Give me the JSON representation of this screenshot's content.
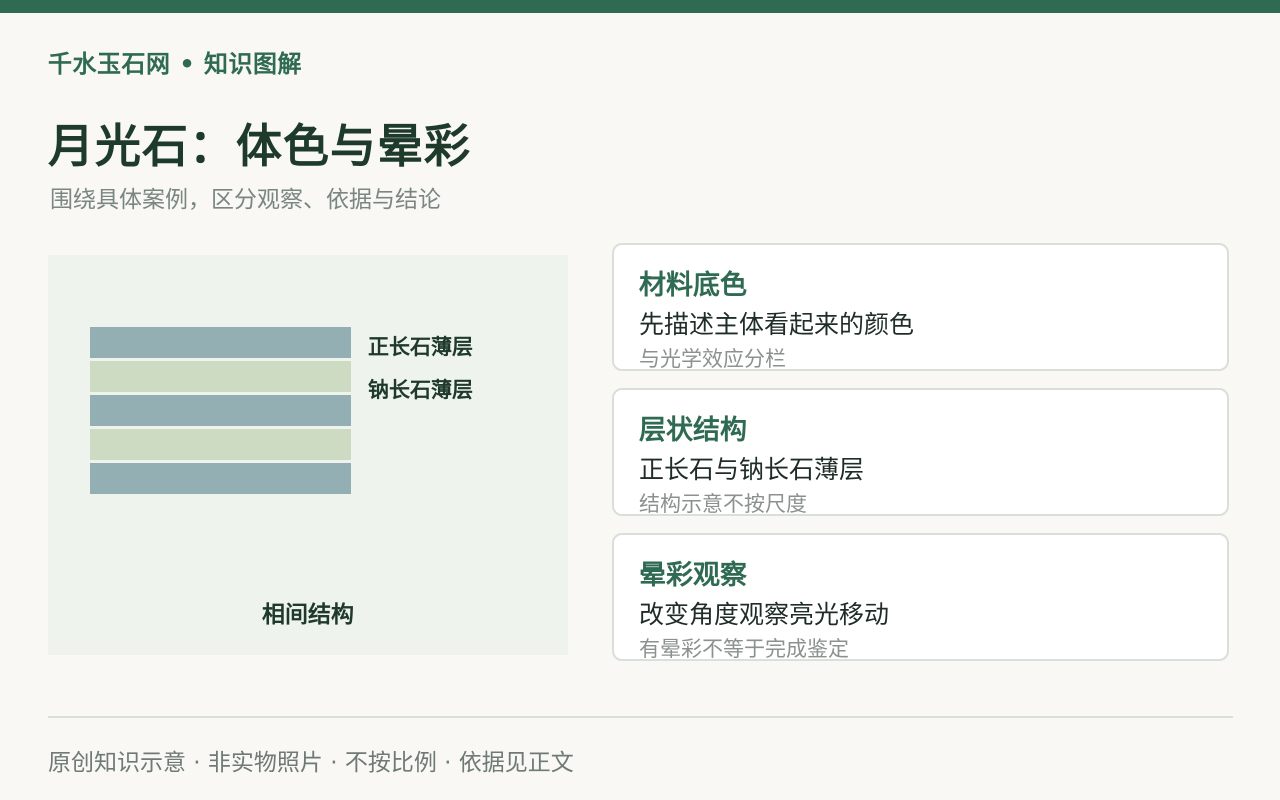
{
  "header": {
    "brand": "千水玉石网 • 知识图解",
    "title": "月光石：体色与晕彩",
    "subtitle": "围绕具体案例，区分观察、依据与结论"
  },
  "diagram": {
    "layers": [
      "orthoclase",
      "albite",
      "orthoclase",
      "albite",
      "orthoclase"
    ],
    "labels": {
      "orthoclase": "正长石薄层",
      "albite": "钠长石薄层"
    },
    "caption": "相间结构",
    "colors": {
      "orthoclase": "#94afb3",
      "albite": "#cddbc3"
    }
  },
  "cards": [
    {
      "title": "材料底色",
      "main": "先描述主体看起来的颜色",
      "note": "与光学效应分栏"
    },
    {
      "title": "层状结构",
      "main": "正长石与钠长石薄层",
      "note": "结构示意不按尺度"
    },
    {
      "title": "晕彩观察",
      "main": "改变角度观察亮光移动",
      "note": "有晕彩不等于完成鉴定"
    }
  ],
  "footer": {
    "text": "原创知识示意 · 非实物照片 · 不按比例 · 依据见正文"
  },
  "colors": {
    "accent": "#2f6a52",
    "background": "#f9f8f4",
    "panel": "#eef3ee"
  }
}
